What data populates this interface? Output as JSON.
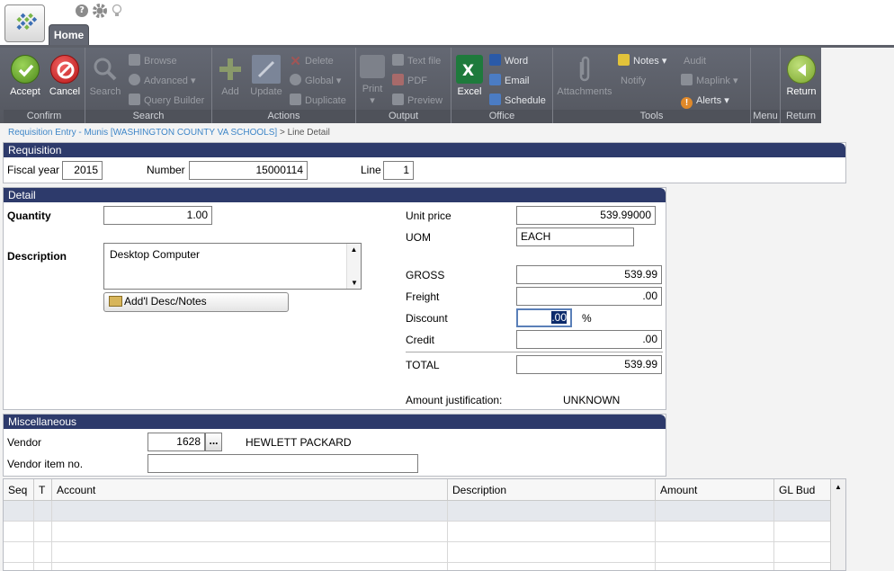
{
  "header": {
    "tab_home": "Home"
  },
  "ribbon": {
    "confirm": {
      "label": "Confirm",
      "accept": "Accept",
      "cancel": "Cancel"
    },
    "search": {
      "label": "Search",
      "search": "Search",
      "browse": "Browse",
      "advanced": "Advanced",
      "query_builder": "Query Builder"
    },
    "actions": {
      "label": "Actions",
      "add": "Add",
      "update": "Update",
      "delete": "Delete",
      "global": "Global",
      "duplicate": "Duplicate"
    },
    "output": {
      "label": "Output",
      "print": "Print",
      "text_file": "Text file",
      "pdf": "PDF",
      "preview": "Preview"
    },
    "office": {
      "label": "Office",
      "excel": "Excel",
      "word": "Word",
      "email": "Email",
      "schedule": "Schedule"
    },
    "tools": {
      "label": "Tools",
      "attachments": "Attachments",
      "notes": "Notes",
      "notify": "Notify",
      "audit": "Audit",
      "maplink": "Maplink",
      "alerts": "Alerts"
    },
    "menu": {
      "label": "Menu"
    },
    "return": {
      "label": "Return",
      "return": "Return"
    }
  },
  "breadcrumb": {
    "link": "Requisition Entry - Munis [WASHINGTON COUNTY VA SCHOOLS]",
    "separator": ">",
    "current": "Line Detail"
  },
  "requisition": {
    "title": "Requisition",
    "fiscal_year_label": "Fiscal year",
    "fiscal_year": "2015",
    "number_label": "Number",
    "number": "15000114",
    "line_label": "Line",
    "line": "1"
  },
  "detail": {
    "title": "Detail",
    "quantity_label": "Quantity",
    "quantity": "1.00",
    "description_label": "Description",
    "description": "Desktop Computer",
    "add_desc_button": "Add'l Desc/Notes",
    "unit_price_label": "Unit price",
    "unit_price": "539.99000",
    "uom_label": "UOM",
    "uom": "EACH",
    "gross_label": "GROSS",
    "gross": "539.99",
    "freight_label": "Freight",
    "freight": ".00",
    "discount_label": "Discount",
    "discount": ".00",
    "discount_unit": "%",
    "credit_label": "Credit",
    "credit": ".00",
    "total_label": "TOTAL",
    "total": "539.99",
    "amount_justification_label": "Amount justification:",
    "amount_justification": "UNKNOWN"
  },
  "misc": {
    "title": "Miscellaneous",
    "vendor_label": "Vendor",
    "vendor": "1628",
    "vendor_lookup": "...",
    "vendor_name": "HEWLETT PACKARD",
    "vendor_item_label": "Vendor item no.",
    "vendor_item": ""
  },
  "grid": {
    "columns": [
      "Seq",
      "T",
      "Account",
      "Description",
      "Amount",
      "GL Bud"
    ]
  },
  "colors": {
    "panel_header": "#2d3a6b",
    "ribbon": "#5d6069",
    "accept": "#6aa32a",
    "cancel": "#d62b2b",
    "link": "#3e86c8"
  }
}
